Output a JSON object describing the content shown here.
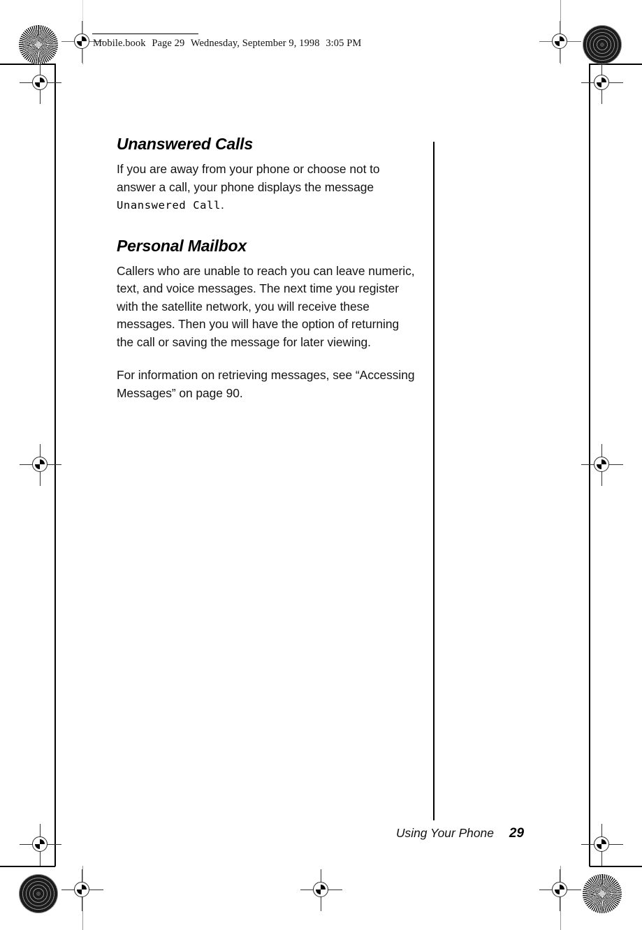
{
  "document": {
    "slug": {
      "file": "Mobile.book",
      "page_label": "Page 29",
      "weekday": "Wednesday,",
      "date": "September 9, 1998",
      "time": "3:05 PM",
      "full": "Mobile.book  Page 29  Wednesday, September 9, 1998  3:05 PM"
    },
    "sections": [
      {
        "heading": "Unanswered Calls",
        "paragraphs": [
          {
            "lead": "If you are away from your phone or choose not to answer a call, your phone displays the message ",
            "device_text": "Unanswered Call",
            "tail": "."
          }
        ]
      },
      {
        "heading": "Personal Mailbox",
        "paragraphs": [
          {
            "text": "Callers who are unable to reach you can leave numeric, text, and voice messages. The next time you register with the satellite network, you will receive these messages. Then you will have the option of returning the call or saving the message for later viewing."
          },
          {
            "text": "For information on retrieving messages, see “Accessing Messages” on page 90."
          }
        ]
      }
    ],
    "footer": {
      "chapter": "Using Your Phone",
      "page_number": "29"
    },
    "marks": {
      "starburst_target": "radial-starburst-registration-target",
      "ring_target": "concentric-ring-registration-target",
      "crosshair": "crosshair-registration-mark"
    },
    "colors": {
      "ink": "#000000",
      "body_text": "#131313",
      "crop_line": "#9a9a9a",
      "paper": "#ffffff"
    }
  }
}
